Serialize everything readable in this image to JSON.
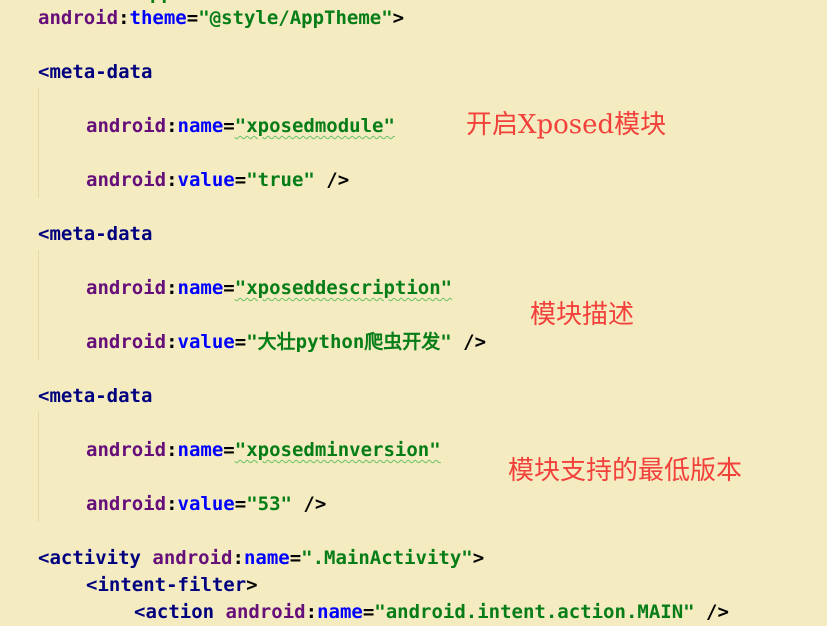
{
  "code": {
    "theme": {
      "ns": "android",
      "colon": ":",
      "attr": "theme",
      "eq": "=",
      "value": "\"@style/AppTheme\"",
      "close": ">"
    },
    "meta1": {
      "open": "<meta-data",
      "name_ns": "android",
      "name_attr": "name",
      "name_value": "\"xposedmodule\"",
      "value_ns": "android",
      "value_attr": "value",
      "value_value": "\"true\"",
      "close": " />"
    },
    "meta2": {
      "open": "<meta-data",
      "name_ns": "android",
      "name_attr": "name",
      "name_value": "\"xposeddescription\"",
      "value_ns": "android",
      "value_attr": "value",
      "value_value": "\"大壮python爬虫开发\"",
      "close": " />"
    },
    "meta3": {
      "open": "<meta-data",
      "name_ns": "android",
      "name_attr": "name",
      "name_value": "\"xposedminversion\"",
      "value_ns": "android",
      "value_attr": "value",
      "value_value": "\"53\"",
      "close": " />"
    },
    "activity": {
      "open": "<activity",
      "ns": "android",
      "attr": "name",
      "value": "\".MainActivity\"",
      "close": ">"
    },
    "intent_filter": {
      "open": "<intent-filter",
      "close": ">"
    },
    "action": {
      "open": "<action",
      "ns": "android",
      "attr": "name",
      "value": "\"android.intent.action.MAIN\"",
      "close": " />"
    },
    "colon": ":",
    "eq": "="
  },
  "annotations": {
    "note1": "开启Xposed模块",
    "note2": "模块描述",
    "note3": "模块支持的最低版本"
  },
  "colors": {
    "background": "#f5ebc0",
    "tag": "#00007f",
    "namespace": "#660e7a",
    "attribute": "#0000ff",
    "value": "#067d17",
    "annotation": "#f2403b"
  }
}
